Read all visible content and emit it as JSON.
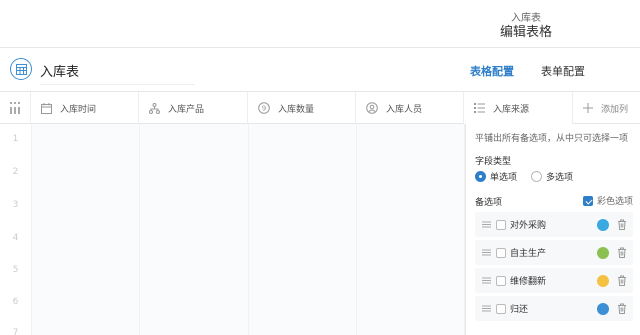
{
  "header": {
    "subtitle": "入库表",
    "title": "编辑表格"
  },
  "toolbar": {
    "table_name": "入库表",
    "tab_grid": "表格配置",
    "tab_form": "表单配置"
  },
  "columns": [
    {
      "label": "入库时间",
      "icon": "calendar-icon"
    },
    {
      "label": "入库产品",
      "icon": "hierarchy-icon"
    },
    {
      "label": "入库数量",
      "icon": "number-icon"
    },
    {
      "label": "入库人员",
      "icon": "user-icon"
    },
    {
      "label": "入库来源",
      "icon": "list-icon"
    }
  ],
  "add_column_label": "添加列",
  "rows": [
    "1",
    "2",
    "3",
    "4",
    "5",
    "6",
    "7"
  ],
  "panel": {
    "hint": "平铺出所有备选项，从中只可选择一项",
    "field_type_label": "字段类型",
    "single_label": "单选项",
    "multi_label": "多选项",
    "options_label": "备选项",
    "colorful_label": "彩色选项",
    "options": [
      {
        "label": "对外采购",
        "color": "#3aa9e0"
      },
      {
        "label": "自主生产",
        "color": "#8cc152"
      },
      {
        "label": "维修翻新",
        "color": "#f5c142"
      },
      {
        "label": "归还",
        "color": "#3d8fd6"
      }
    ]
  },
  "colors": {
    "accent": "#2e7ec9",
    "border": "#e6e6e6"
  }
}
